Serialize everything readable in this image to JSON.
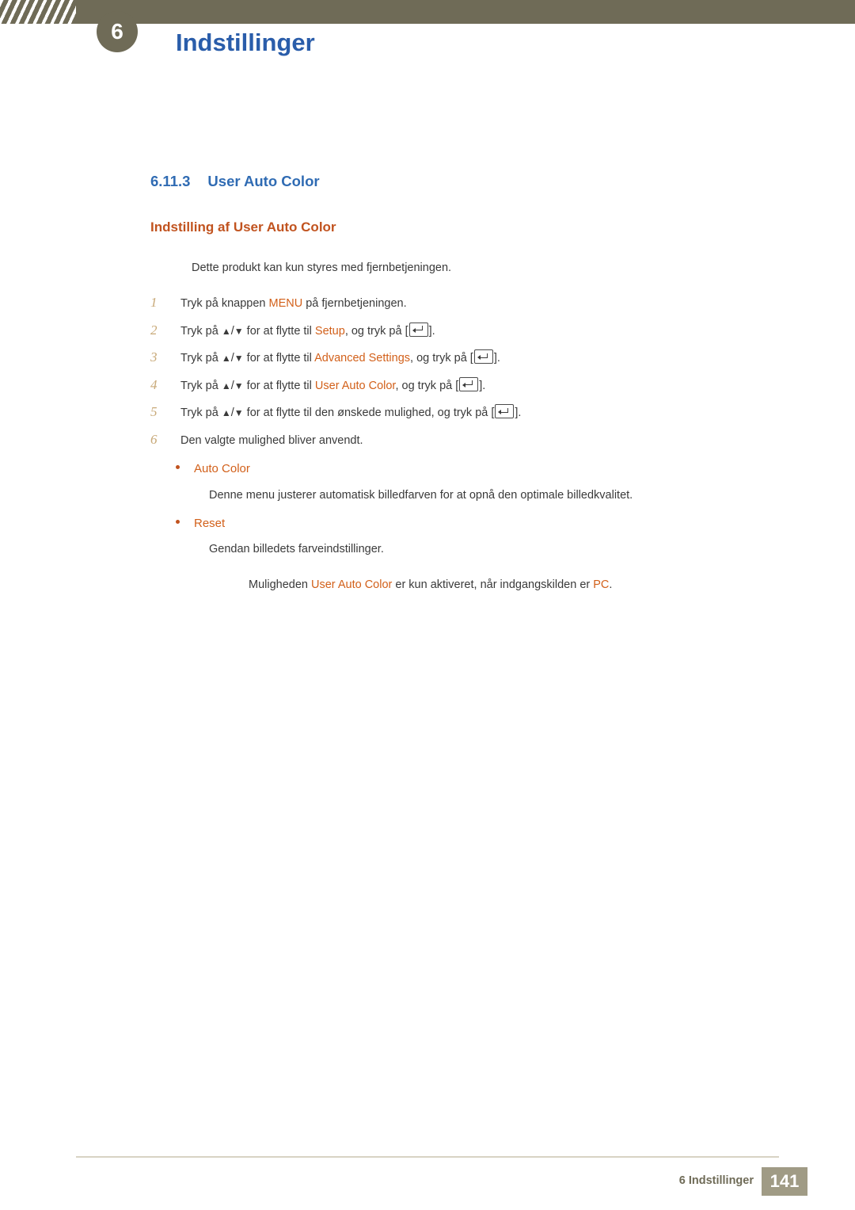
{
  "header": {
    "chapter_number": "6",
    "chapter_title": "Indstillinger"
  },
  "section": {
    "number": "6.11.3",
    "title": "User Auto Color",
    "subheading": "Indstilling af User Auto Color",
    "note": "Dette produkt kan kun styres med fjernbetjeningen."
  },
  "steps": [
    {
      "num": "1",
      "parts": [
        {
          "t": "Tryk på knappen ",
          "c": "plain"
        },
        {
          "t": "MENU",
          "c": "orange"
        },
        {
          "t": " på fjernbetjeningen.",
          "c": "plain"
        }
      ]
    },
    {
      "num": "2",
      "parts": [
        {
          "t": "Tryk på ",
          "c": "plain"
        },
        {
          "t": "▲",
          "c": "arrow"
        },
        {
          "t": "/",
          "c": "plain"
        },
        {
          "t": "▼",
          "c": "arrow"
        },
        {
          "t": " for at flytte til ",
          "c": "plain"
        },
        {
          "t": "Setup",
          "c": "orange"
        },
        {
          "t": ", og tryk på [",
          "c": "plain"
        },
        {
          "t": "",
          "c": "enter"
        },
        {
          "t": "].",
          "c": "plain"
        }
      ]
    },
    {
      "num": "3",
      "parts": [
        {
          "t": "Tryk på ",
          "c": "plain"
        },
        {
          "t": "▲",
          "c": "arrow"
        },
        {
          "t": "/",
          "c": "plain"
        },
        {
          "t": "▼",
          "c": "arrow"
        },
        {
          "t": " for at flytte til ",
          "c": "plain"
        },
        {
          "t": "Advanced Settings",
          "c": "orange"
        },
        {
          "t": ", og tryk på [",
          "c": "plain"
        },
        {
          "t": "",
          "c": "enter"
        },
        {
          "t": "].",
          "c": "plain"
        }
      ]
    },
    {
      "num": "4",
      "parts": [
        {
          "t": "Tryk på ",
          "c": "plain"
        },
        {
          "t": "▲",
          "c": "arrow"
        },
        {
          "t": "/",
          "c": "plain"
        },
        {
          "t": "▼",
          "c": "arrow"
        },
        {
          "t": " for at flytte til ",
          "c": "plain"
        },
        {
          "t": "User Auto Color",
          "c": "orange"
        },
        {
          "t": ", og tryk på [",
          "c": "plain"
        },
        {
          "t": "",
          "c": "enter"
        },
        {
          "t": "].",
          "c": "plain"
        }
      ]
    },
    {
      "num": "5",
      "parts": [
        {
          "t": "Tryk på ",
          "c": "plain"
        },
        {
          "t": "▲",
          "c": "arrow"
        },
        {
          "t": "/",
          "c": "plain"
        },
        {
          "t": "▼",
          "c": "arrow"
        },
        {
          "t": " for at flytte til den ønskede mulighed, og tryk på [",
          "c": "plain"
        },
        {
          "t": "",
          "c": "enter"
        },
        {
          "t": "].",
          "c": "plain"
        }
      ]
    },
    {
      "num": "6",
      "parts": [
        {
          "t": "Den valgte mulighed bliver anvendt.",
          "c": "plain"
        }
      ]
    }
  ],
  "options": [
    {
      "label": "Auto Color",
      "description": "Denne menu justerer automatisk billedfarven for at opnå den optimale billedkvalitet."
    },
    {
      "label": "Reset",
      "description": "Gendan billedets farveindstillinger."
    }
  ],
  "footnote": {
    "parts": [
      {
        "t": "Muligheden ",
        "c": "plain"
      },
      {
        "t": "User Auto Color",
        "c": "orange"
      },
      {
        "t": " er kun aktiveret, når indgangskilden er ",
        "c": "plain"
      },
      {
        "t": "PC",
        "c": "orange"
      },
      {
        "t": ".",
        "c": "plain"
      }
    ]
  },
  "footer": {
    "label": "6 Indstillinger",
    "page_number": "141"
  },
  "colors": {
    "header_band": "#6f6b57",
    "chapter_title": "#2a5daa",
    "section_heading": "#2f6bb3",
    "subheading": "#c1531f",
    "keyword": "#d2601a",
    "step_number": "#c8a978",
    "footer": "#6f6b57",
    "page_badge": "#a09b85"
  }
}
